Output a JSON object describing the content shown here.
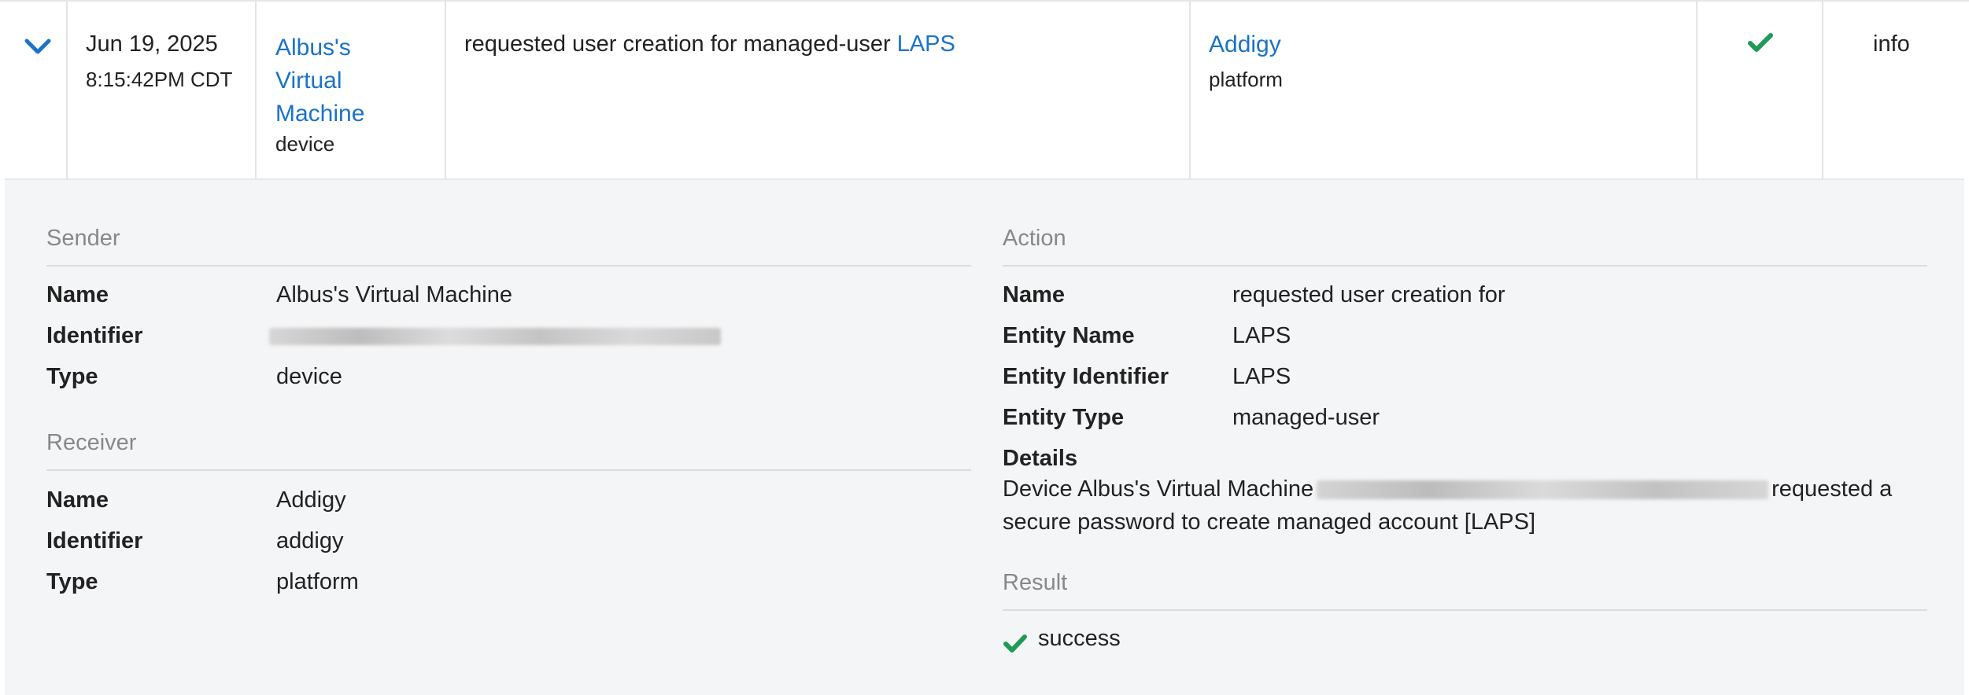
{
  "row": {
    "date": "Jun 19, 2025",
    "time": "8:15:42PM CDT",
    "sender_name_lines": [
      "Albus's",
      "Virtual",
      "Machine"
    ],
    "sender_type": "device",
    "message_prefix": "requested user creation for managed-user",
    "message_entity": "LAPS",
    "receiver_name": "Addigy",
    "receiver_type": "platform",
    "status_icon": "check-icon",
    "level": "info"
  },
  "sender": {
    "title": "Sender",
    "name_label": "Name",
    "name_value": "Albus's Virtual Machine",
    "identifier_label": "Identifier",
    "type_label": "Type",
    "type_value": "device"
  },
  "receiver": {
    "title": "Receiver",
    "name_label": "Name",
    "name_value": "Addigy",
    "identifier_label": "Identifier",
    "identifier_value": "addigy",
    "type_label": "Type",
    "type_value": "platform"
  },
  "action": {
    "title": "Action",
    "name_label": "Name",
    "name_value": "requested user creation for",
    "entity_name_label": "Entity Name",
    "entity_name_value": "LAPS",
    "entity_identifier_label": "Entity Identifier",
    "entity_identifier_value": "LAPS",
    "entity_type_label": "Entity Type",
    "entity_type_value": "managed-user",
    "details_label": "Details",
    "details_prefix": "Device Albus's Virtual Machine",
    "details_suffix": "requested a secure password to create managed account [LAPS]"
  },
  "result": {
    "title": "Result",
    "value": "success"
  },
  "colors": {
    "link": "#1a73c8",
    "success": "#1e9b57"
  }
}
